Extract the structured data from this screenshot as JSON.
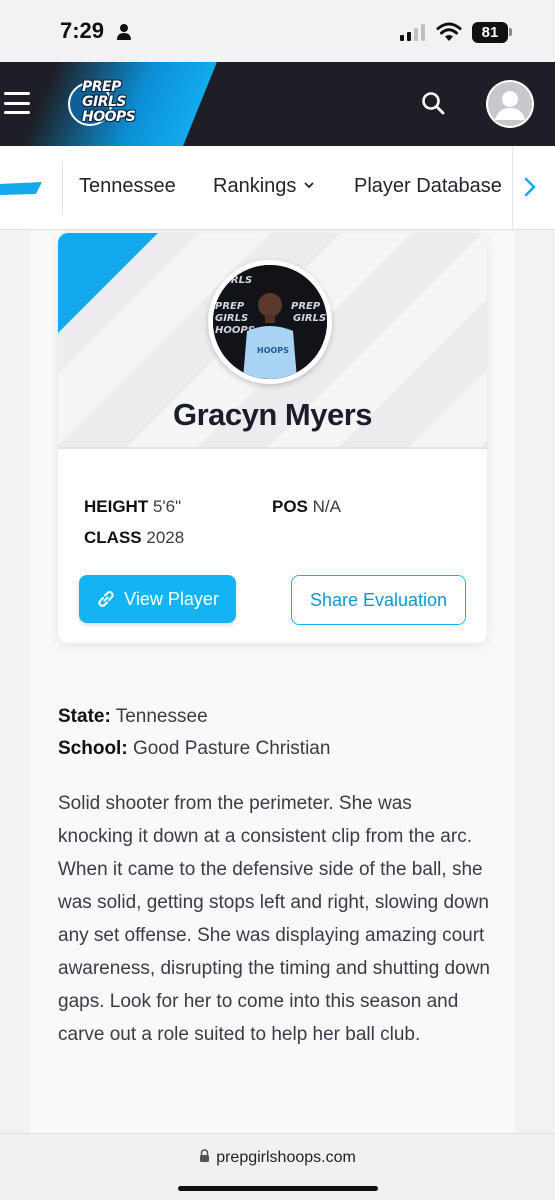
{
  "status_bar": {
    "time": "7:29",
    "battery": "81"
  },
  "header": {
    "logo_lines": [
      "PREP",
      "GIRLS",
      "HOOPS"
    ]
  },
  "nav": {
    "items": [
      "Tennessee",
      "Rankings",
      "Player Database"
    ]
  },
  "player": {
    "name": "Gracyn Myers",
    "height_label": "HEIGHT",
    "height": "5'6\"",
    "pos_label": "POS",
    "pos": "N/A",
    "class_label": "CLASS",
    "class": "2028",
    "view_button": "View Player",
    "share_button": "Share Evaluation"
  },
  "details": {
    "state_label": "State:",
    "state": "Tennessee",
    "school_label": "School:",
    "school": "Good Pasture Christian",
    "evaluation": "Solid shooter from the perimeter. She was knocking it down at a consistent clip from the arc. When it came to the defensive side of the ball, she was solid, getting stops left and right, slowing down any set offense. She was displaying amazing court awareness, disrupting the timing and shutting down gaps. Look for her to come into this season and carve out a role suited to help her ball club."
  },
  "browser": {
    "url": "prepgirlshoops.com"
  },
  "colors": {
    "accent": "#14b4f4",
    "header_bg": "#1e1f26"
  }
}
